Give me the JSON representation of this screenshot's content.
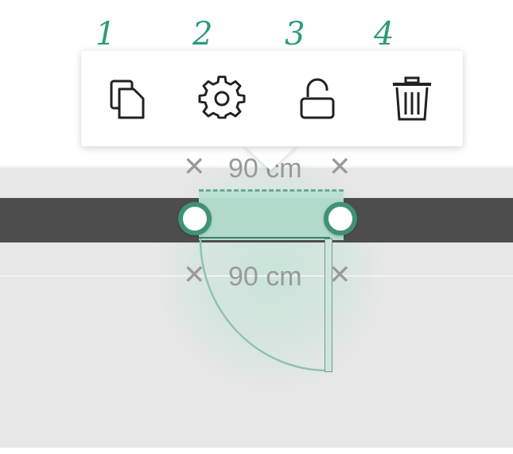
{
  "toolbar": {
    "buttons": [
      {
        "icon": "copy-icon",
        "action": "duplicate"
      },
      {
        "icon": "gear-icon",
        "action": "settings"
      },
      {
        "icon": "unlock-icon",
        "action": "lock-toggle"
      },
      {
        "icon": "trash-icon",
        "action": "delete"
      }
    ]
  },
  "annotations": [
    "1",
    "2",
    "3",
    "4"
  ],
  "dimensions": {
    "outer_label": "90 cm",
    "inner_label": "90 cm"
  },
  "colors": {
    "accent": "#3f9276",
    "selection_fill": "#b6e2d2",
    "wall": "#4d4d4d",
    "floor": "#e7e7e7",
    "annotation": "#2f9a7a"
  }
}
